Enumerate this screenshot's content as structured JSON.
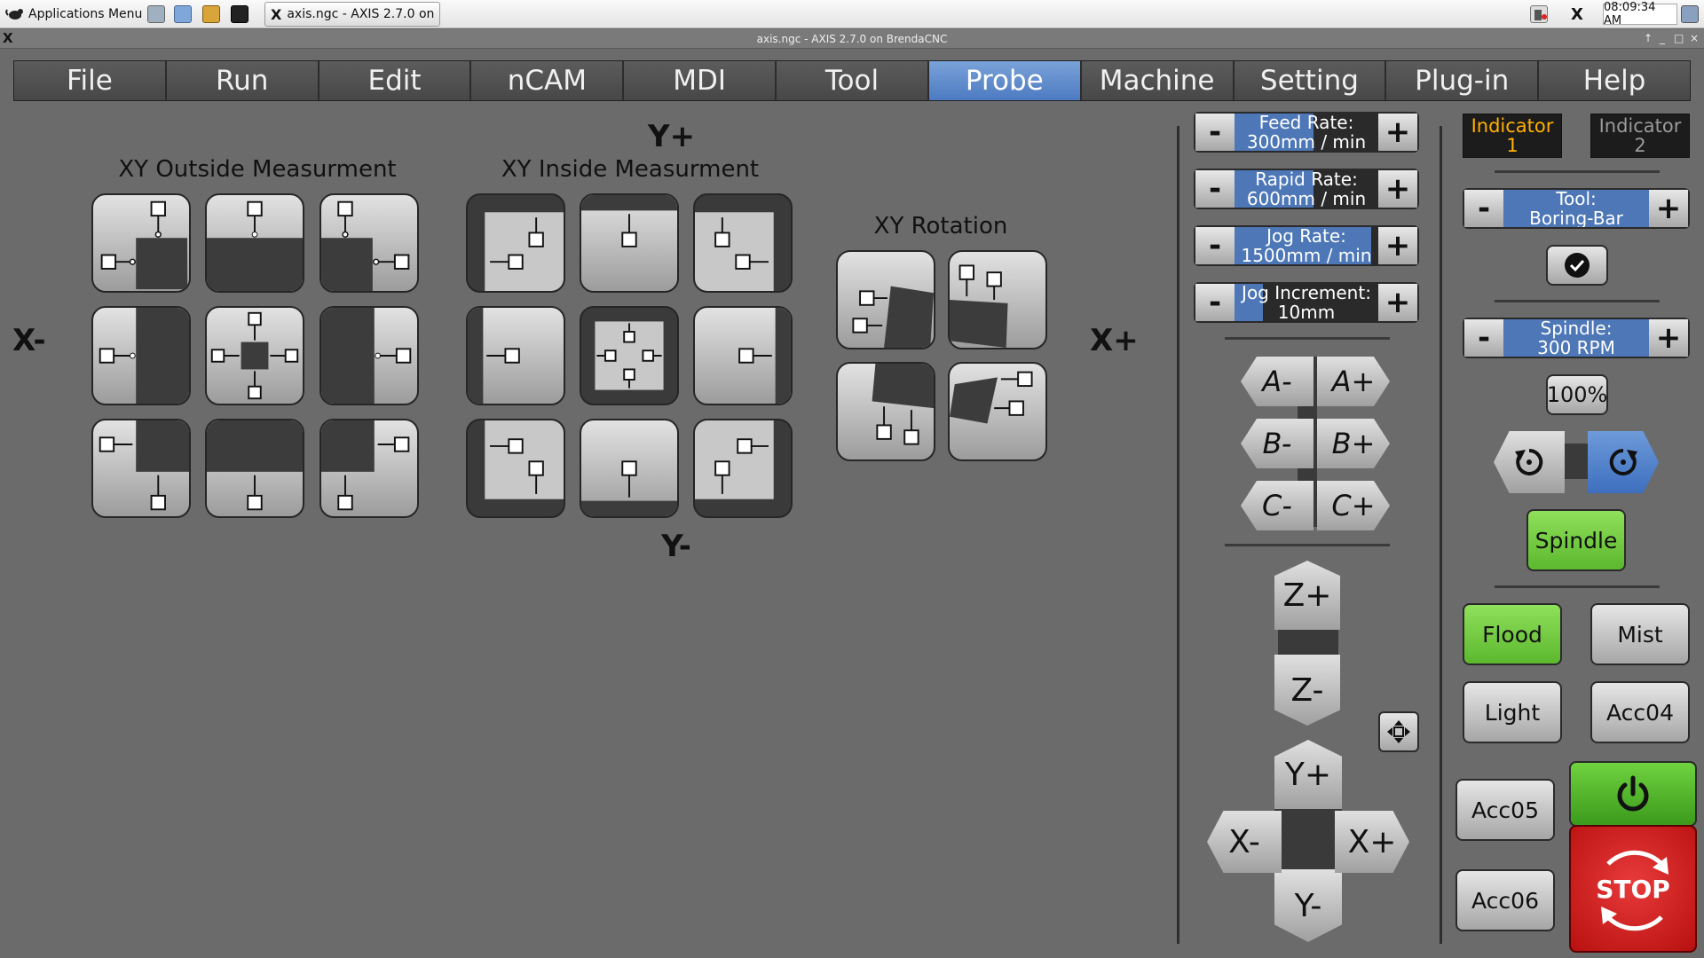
{
  "taskbar": {
    "apps_menu": "Applications Menu",
    "task_title": "axis.ngc - AXIS 2.7.0 on ...",
    "clock": "08:09:34 AM"
  },
  "window": {
    "title": "axis.ngc - AXIS 2.7.0 on BrendaCNC",
    "icon_letter": "X"
  },
  "menu": [
    "File",
    "Run",
    "Edit",
    "nCAM",
    "MDI",
    "Tool",
    "Probe",
    "Machine",
    "Setting",
    "Plug-in",
    "Help"
  ],
  "active_menu": "Probe",
  "probe": {
    "outside_title": "XY Outside Measurment",
    "inside_title": "XY Inside Measurment",
    "rotation_title": "XY Rotation",
    "y_plus": "Y+",
    "y_minus": "Y-",
    "x_minus": "X-",
    "x_plus": "X+"
  },
  "rates": {
    "feed": {
      "label": "Feed Rate:",
      "value": "300mm / min",
      "level": 0.55
    },
    "rapid": {
      "label": "Rapid Rate:",
      "value": "600mm / min",
      "level": 0.55
    },
    "jog": {
      "label": "Jog Rate:",
      "value": "1500mm / min",
      "level": 0.95
    },
    "increment": {
      "label": "Jog Increment:",
      "value": "10mm",
      "level": 0.2
    },
    "minus": "-",
    "plus": "+"
  },
  "jog": {
    "a_minus": "A-",
    "a_plus": "A+",
    "b_minus": "B-",
    "b_plus": "B+",
    "c_minus": "C-",
    "c_plus": "C+",
    "z_plus": "Z+",
    "z_minus": "Z-",
    "y_plus": "Y+",
    "y_minus": "Y-",
    "x_minus": "X-",
    "x_plus": "X+"
  },
  "right_panel": {
    "indicator1_title": "Indicator",
    "indicator1_num": "1",
    "indicator2_title": "Indicator",
    "indicator2_num": "2",
    "tool_label": "Tool:",
    "tool_value": "Boring-Bar",
    "spindle_label": "Spindle:",
    "spindle_value": "300 RPM",
    "spindle_override": "100%",
    "spindle_button": "Spindle",
    "flood": "Flood",
    "mist": "Mist",
    "light": "Light",
    "acc04": "Acc04",
    "acc05": "Acc05",
    "acc06": "Acc06",
    "stop": "STOP"
  },
  "colors": {
    "background": "#6b6b6b",
    "active_menu": "#5a86c8",
    "green": "#6fcb3a",
    "stop_red": "#d11f1f",
    "indicator_active": "#ffb000",
    "indicator_inactive": "#9a9a9a"
  }
}
